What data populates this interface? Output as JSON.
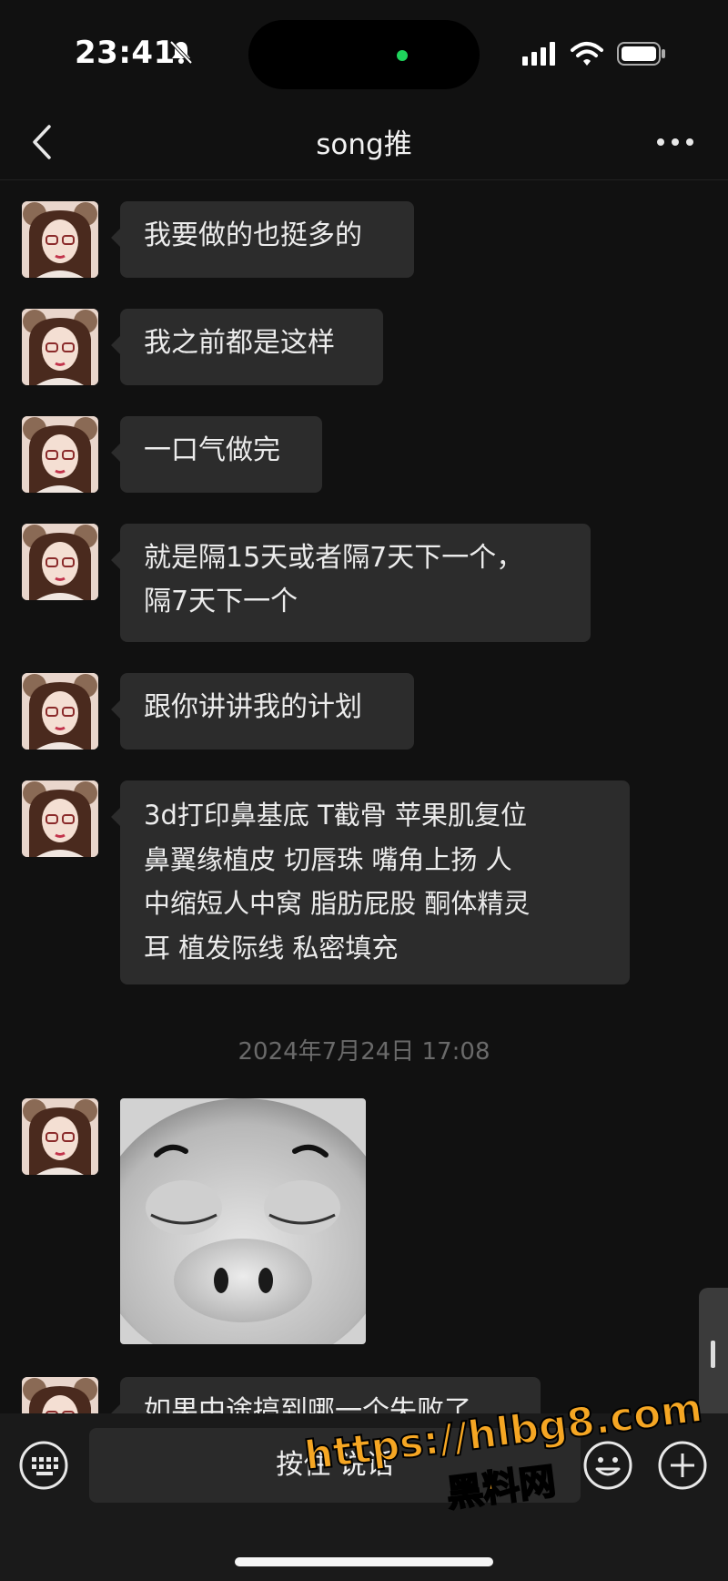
{
  "status_bar": {
    "time": "23:41"
  },
  "nav": {
    "title": "song推"
  },
  "messages": [
    {
      "text": "我要做的也挺多的"
    },
    {
      "text": "我之前都是这样"
    },
    {
      "text": "一口气做完"
    },
    {
      "lines": [
        "就是隔15天或者隔7天下一个，",
        "隔7天下一个"
      ]
    },
    {
      "text": "跟你讲讲我的计划"
    },
    {
      "lines": [
        "3d打印鼻基底 T截骨 苹果肌复位",
        "鼻翼缘植皮  切唇珠 嘴角上扬 人",
        "中缩短人中窝 脂肪屁股  酮体精灵",
        "耳 植发际线 私密填充"
      ]
    },
    {
      "text": "如果中途搞到哪一个失败了"
    }
  ],
  "timestamp": "2024年7月24日 17:08",
  "input_bar": {
    "hold_to_talk": "按住 说话"
  },
  "watermark": {
    "url": "https://hlbg8.com",
    "name": "黑料网"
  },
  "icons": [
    "bell-slash-icon",
    "signal-icon",
    "wifi-icon",
    "battery-icon",
    "back-chevron-icon",
    "more-icon",
    "keyboard-icon",
    "emoji-icon",
    "plus-icon"
  ],
  "colors": {
    "background": "#111111",
    "bubble": "#2c2c2c",
    "online_dot": "#1fd35c",
    "watermark": "#f5a623"
  }
}
